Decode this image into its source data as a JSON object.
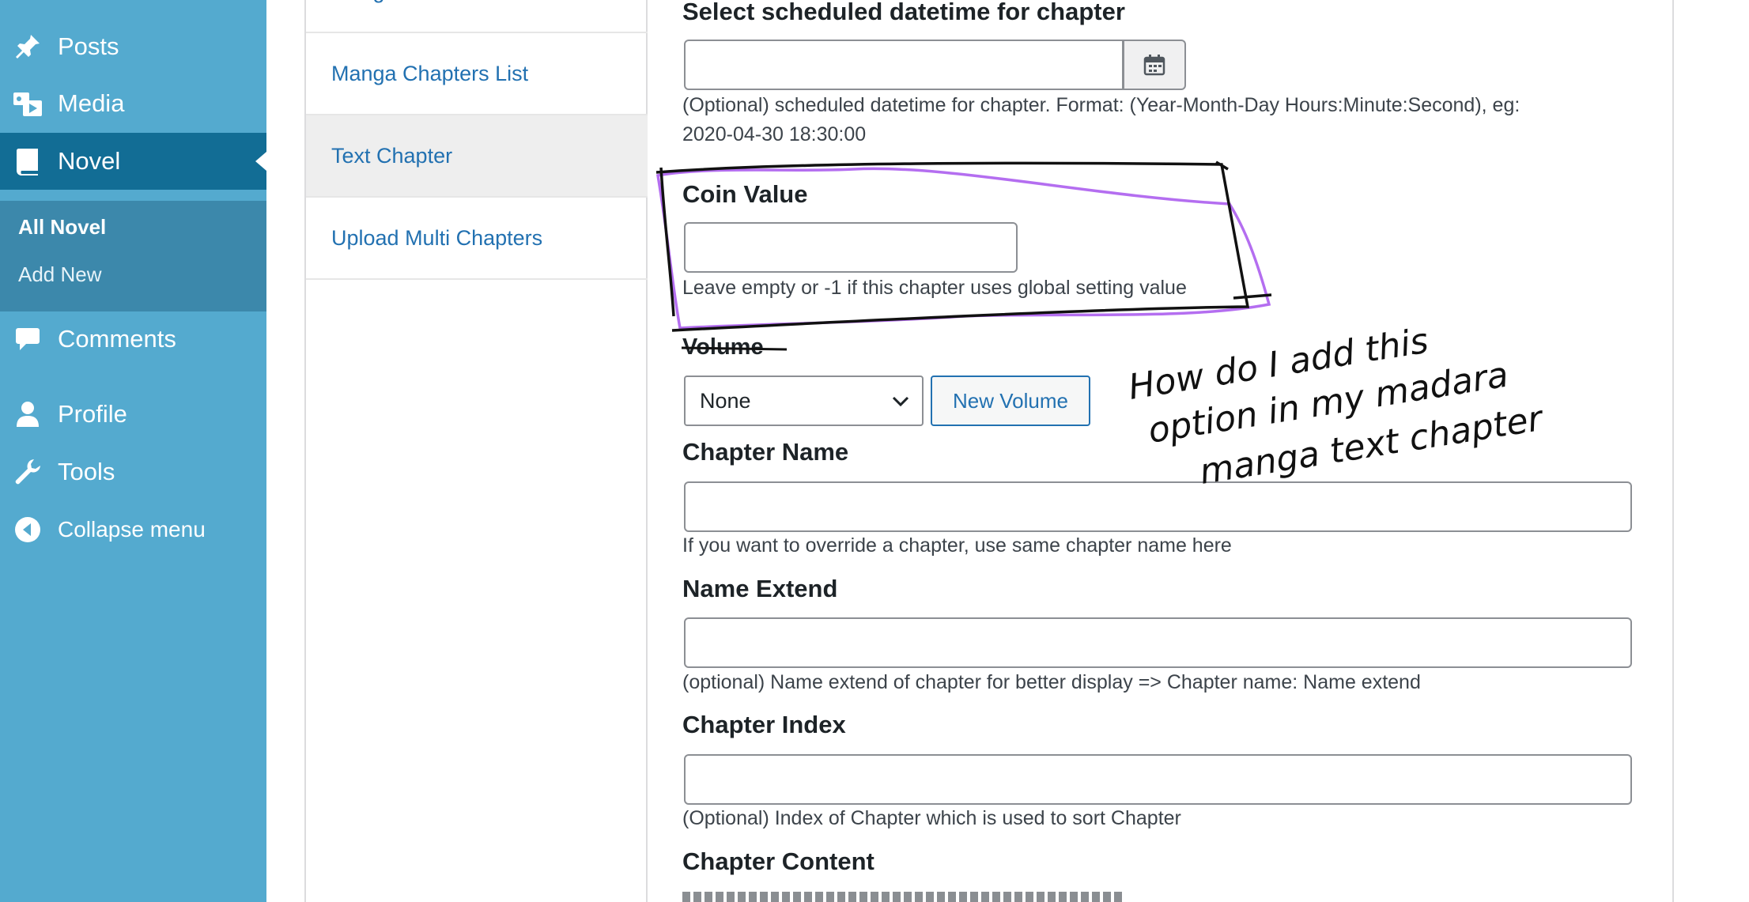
{
  "sidebar": {
    "menu": [
      {
        "label": "Posts",
        "icon": "pin-icon"
      },
      {
        "label": "Media",
        "icon": "media-icon"
      },
      {
        "label": "Novel",
        "icon": "book-icon"
      },
      {
        "label": "Comments",
        "icon": "comment-icon"
      },
      {
        "label": "Profile",
        "icon": "user-icon"
      },
      {
        "label": "Tools",
        "icon": "wrench-icon"
      },
      {
        "label": "Collapse menu",
        "icon": "collapse-icon"
      }
    ],
    "submenu": [
      {
        "label": "All Novel"
      },
      {
        "label": "Add New"
      }
    ],
    "colors": {
      "base": "#54aacf",
      "current": "#126d95",
      "submenu": "#3c88ab"
    }
  },
  "tabs": {
    "items": [
      {
        "label": "Manga Chapters List"
      },
      {
        "label": "Text Chapter"
      },
      {
        "label": "Upload Multi Chapters"
      }
    ],
    "active": "Text Chapter"
  },
  "form": {
    "scheduled": {
      "label": "Select scheduled datetime for chapter",
      "value": "",
      "description": "(Optional) scheduled datetime for chapter. Format: (Year-Month-Day Hours:Minute:Second), eg:",
      "description_2": "2020-04-30 18:30:00"
    },
    "coin_value": {
      "label": "Coin Value",
      "value": "",
      "description": "Leave empty or -1 if this chapter uses global setting value"
    },
    "volume": {
      "label": "Volume",
      "selected": "None",
      "new_button": "New Volume"
    },
    "chapter_name": {
      "label": "Chapter Name",
      "value": "",
      "description": "If you want to override a chapter, use same chapter name here"
    },
    "name_extend": {
      "label": "Name Extend",
      "value": "",
      "description": "(optional) Name extend of chapter for better display => Chapter name: Name extend"
    },
    "chapter_index": {
      "label": "Chapter Index",
      "value": "",
      "description": "(Optional) Index of Chapter which is used to sort Chapter"
    },
    "chapter_content": {
      "label": "Chapter Content"
    }
  },
  "annotation": {
    "lines": [
      "How do I add this",
      "option in my madara",
      "manga text chapter"
    ],
    "colors": {
      "ink": "#111111",
      "highlight": "#b46ef0"
    }
  }
}
